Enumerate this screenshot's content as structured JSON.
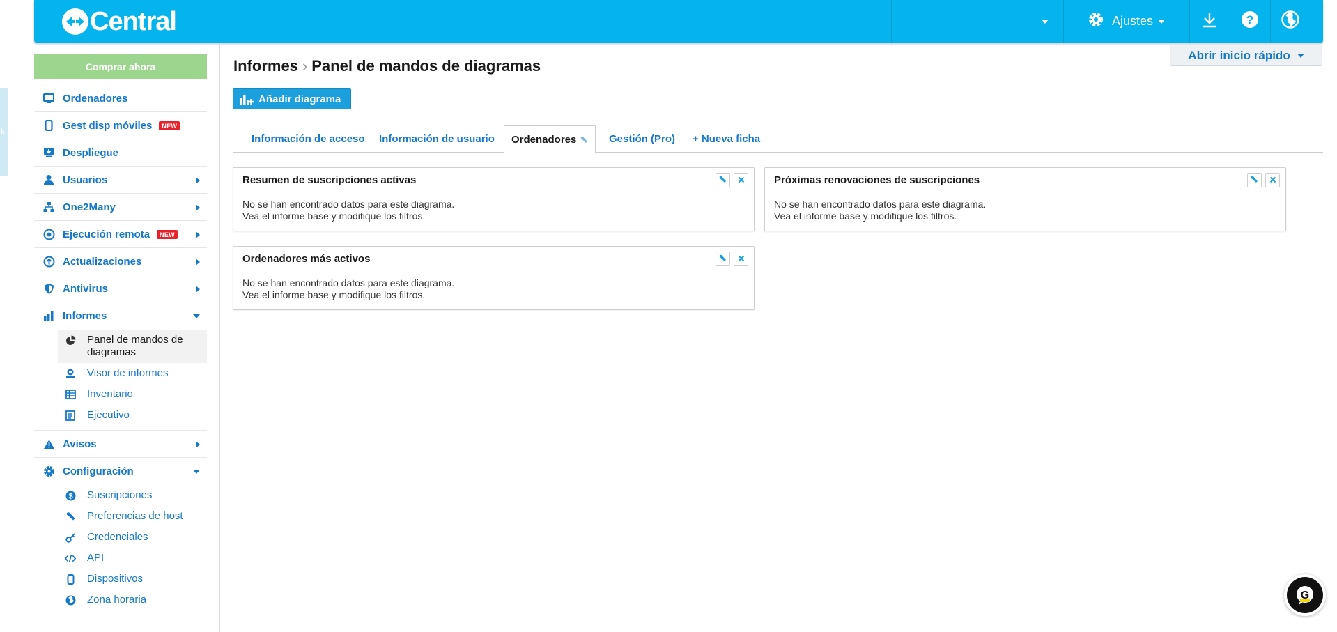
{
  "colors": {
    "brand": "#05b4ec",
    "link": "#1579c8",
    "buy": "#9cd58d",
    "badge": "#e8212b",
    "primary_button": "#1c9fdd"
  },
  "edge_tab": {
    "label": "k"
  },
  "topbar": {
    "logo_text": "Central",
    "settings_label": "Ajustes",
    "icons": [
      "chevron-down-icon",
      "gear-icon",
      "download-icon",
      "help-icon",
      "globe-icon"
    ]
  },
  "sidebar": {
    "buy_label": "Comprar ahora",
    "items": [
      {
        "label": "Ordenadores",
        "icon": "monitor-icon"
      },
      {
        "label": "Gest disp móviles",
        "icon": "mobile-icon",
        "badge": "NEW"
      },
      {
        "label": "Despliegue",
        "icon": "deploy-icon"
      },
      {
        "label": "Usuarios",
        "icon": "user-icon"
      },
      {
        "label": "One2Many",
        "icon": "hierarchy-icon"
      },
      {
        "label": "Ejecución remota",
        "icon": "remote-exec-icon",
        "badge": "NEW"
      },
      {
        "label": "Actualizaciones",
        "icon": "update-icon"
      },
      {
        "label": "Antivirus",
        "icon": "shield-icon"
      },
      {
        "label": "Informes",
        "icon": "bar-chart-icon"
      },
      {
        "label": "Avisos",
        "icon": "warning-icon"
      },
      {
        "label": "Configuración",
        "icon": "gear-icon"
      }
    ],
    "informes_sub": [
      {
        "label": "Panel de mandos de diagramas",
        "icon": "pie-chart-icon",
        "active": true
      },
      {
        "label": "Visor de informes",
        "icon": "report-viewer-icon"
      },
      {
        "label": "Inventario",
        "icon": "table-icon"
      },
      {
        "label": "Ejecutivo",
        "icon": "executive-icon"
      }
    ],
    "config_sub": [
      {
        "label": "Suscripciones",
        "icon": "dollar-icon"
      },
      {
        "label": "Preferencias de host",
        "icon": "wrench-icon"
      },
      {
        "label": "Credenciales",
        "icon": "key-icon"
      },
      {
        "label": "API",
        "icon": "code-icon"
      },
      {
        "label": "Dispositivos",
        "icon": "device-icon"
      },
      {
        "label": "Zona horaria",
        "icon": "globe-icon"
      }
    ]
  },
  "main": {
    "breadcrumb_parent": "Informes",
    "breadcrumb_sep": "›",
    "breadcrumb_current": "Panel de mandos de diagramas",
    "quick_start_label": "Abrir inicio rápido",
    "add_chart_label": "Añadir diagrama",
    "tabs": [
      {
        "label": "Información de acceso"
      },
      {
        "label": "Información de usuario"
      },
      {
        "label": "Ordenadores",
        "active": true
      },
      {
        "label": "Gestión (Pro)"
      },
      {
        "label": "+ Nueva ficha"
      }
    ],
    "cards": [
      {
        "title": "Resumen de suscripciones activas",
        "msg1": "No se han encontrado datos para este diagrama.",
        "msg2": "Vea el informe base y modifique los filtros."
      },
      {
        "title": "Próximas renovaciones de suscripciones",
        "msg1": "No se han encontrado datos para este diagrama.",
        "msg2": "Vea el informe base y modifique los filtros."
      },
      {
        "title": "Ordenadores más activos",
        "msg1": "No se han encontrado datos para este diagrama.",
        "msg2": "Vea el informe base y modifique los filtros."
      }
    ]
  },
  "chat": {
    "letter": "G"
  }
}
